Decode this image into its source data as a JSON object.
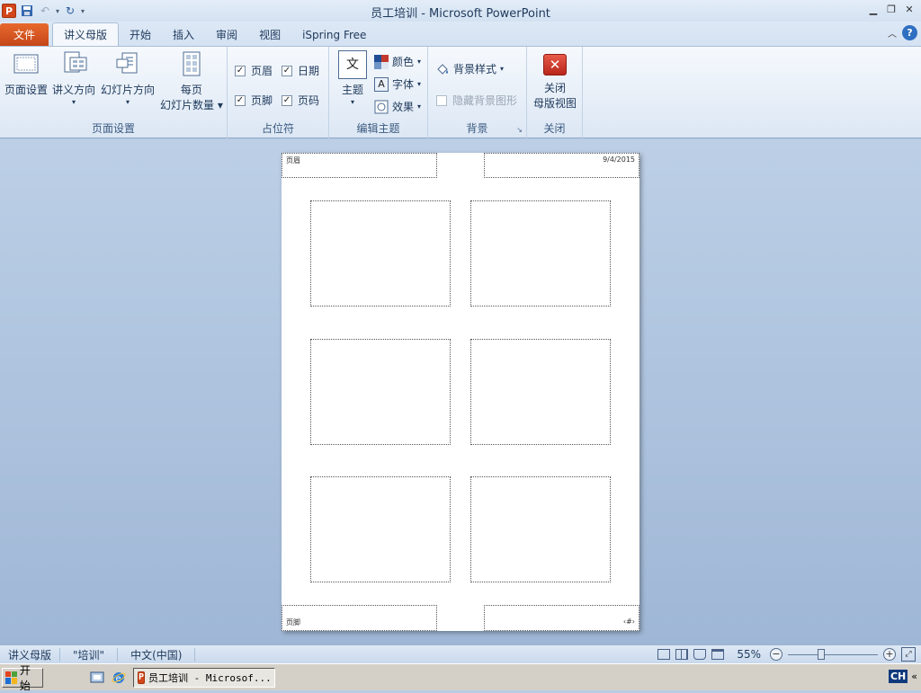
{
  "window": {
    "title": "员工培训 - Microsoft PowerPoint"
  },
  "qat": {
    "app_icon": "P"
  },
  "tabs": [
    {
      "id": "file",
      "label": "文件"
    },
    {
      "id": "handout",
      "label": "讲义母版"
    },
    {
      "id": "home",
      "label": "开始"
    },
    {
      "id": "insert",
      "label": "插入"
    },
    {
      "id": "review",
      "label": "审阅"
    },
    {
      "id": "view",
      "label": "视图"
    },
    {
      "id": "ispring",
      "label": "iSpring Free"
    }
  ],
  "ribbon": {
    "page_setup_group": {
      "label": "页面设置",
      "page_setup": "页面设置",
      "handout_orientation": "讲义方向",
      "slide_orientation": "幻灯片方向",
      "slides_per_page_1": "每页",
      "slides_per_page_2": "幻灯片数量"
    },
    "placeholders_group": {
      "label": "占位符",
      "header": "页眉",
      "date": "日期",
      "footer": "页脚",
      "page_number": "页码"
    },
    "edit_theme_group": {
      "label": "编辑主题",
      "themes": "主题",
      "theme_glyph": "文",
      "colors": "颜色",
      "fonts": "字体",
      "effects": "效果"
    },
    "background_group": {
      "label": "背景",
      "background_styles": "背景样式",
      "hide_background": "隐藏背景图形"
    },
    "close_group": {
      "label": "关闭",
      "close_1": "关闭",
      "close_2": "母版视图"
    }
  },
  "handout": {
    "header_text": "页眉",
    "date_text": "9/4/2015",
    "footer_text": "页脚",
    "page_num_text": "‹#›"
  },
  "status": {
    "view_name": "讲义母版",
    "theme_name": "\"培训\"",
    "language": "中文(中国)",
    "zoom": "55%",
    "zoom_fraction": 0.55
  },
  "taskbar": {
    "start": "开始",
    "app_label": "员工培训 - Microsof...",
    "ime": "CH"
  }
}
